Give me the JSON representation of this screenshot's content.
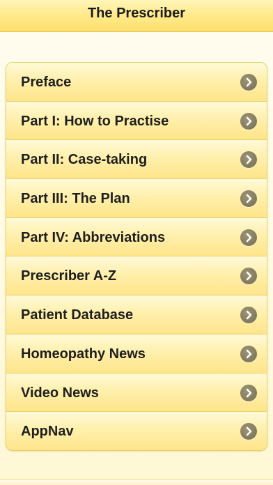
{
  "header": {
    "title": "The Prescriber"
  },
  "menu": {
    "items": [
      {
        "label": "Preface",
        "icon": "chevron-right-icon"
      },
      {
        "label": "Part I: How to Practise",
        "icon": "chevron-right-icon"
      },
      {
        "label": "Part II: Case-taking",
        "icon": "chevron-right-icon"
      },
      {
        "label": "Part III: The Plan",
        "icon": "chevron-right-icon"
      },
      {
        "label": "Part IV: Abbreviations",
        "icon": "chevron-right-icon"
      },
      {
        "label": "Prescriber A-Z",
        "icon": "chevron-right-icon"
      },
      {
        "label": "Patient Database",
        "icon": "chevron-right-icon"
      },
      {
        "label": "Homeopathy News",
        "icon": "chevron-right-icon"
      },
      {
        "label": "Video News",
        "icon": "chevron-right-icon"
      },
      {
        "label": "AppNav",
        "icon": "chevron-right-icon"
      }
    ]
  },
  "colors": {
    "nav_bar": "#ffe886",
    "row_background": "#fff0ad",
    "row_border": "#e8cf6e",
    "chevron": "#857d5f",
    "text": "#1e1e1e"
  }
}
